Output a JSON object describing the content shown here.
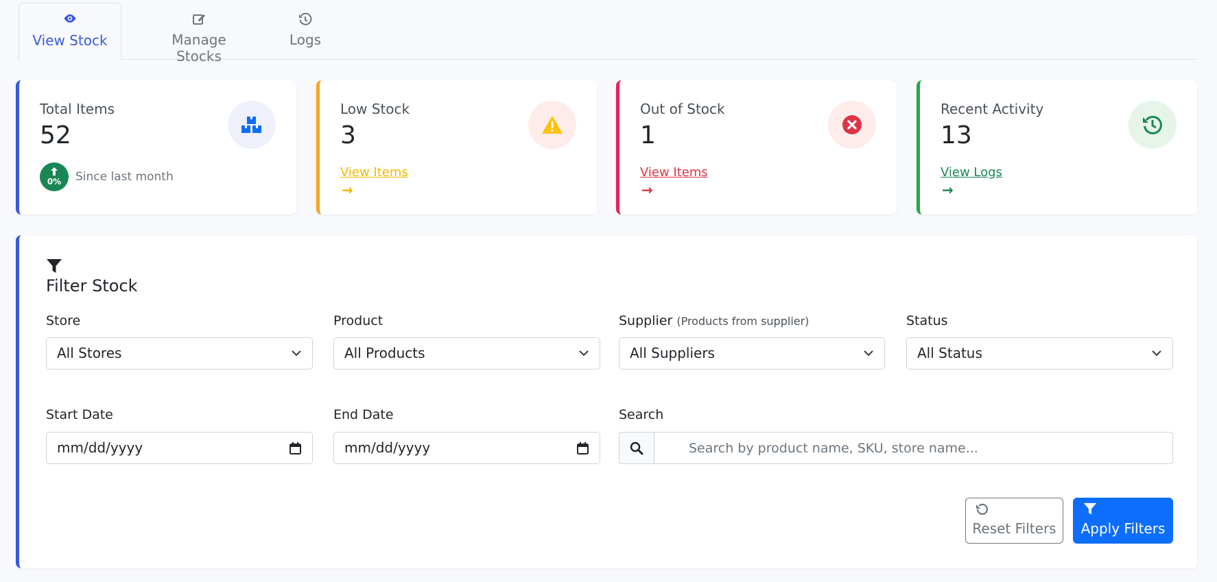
{
  "tabs": [
    {
      "label": "View Stock",
      "icon": "eye-icon"
    },
    {
      "label": "Manage Stocks",
      "icon": "edit-icon"
    },
    {
      "label": "Logs",
      "icon": "history-icon"
    }
  ],
  "cards": {
    "total": {
      "title": "Total Items",
      "value": "52",
      "badge_pct": "0%",
      "since": "Since last month",
      "icon": "boxes-icon",
      "accent": "#3a5bd9"
    },
    "low": {
      "title": "Low Stock",
      "value": "3",
      "link": "View Items",
      "icon": "warning-icon",
      "accent": "#f5a623"
    },
    "out": {
      "title": "Out of Stock",
      "value": "1",
      "link": "View Items",
      "icon": "x-circle-icon",
      "accent": "#e0245e"
    },
    "recent": {
      "title": "Recent Activity",
      "value": "13",
      "link": "View Logs",
      "icon": "history-icon",
      "accent": "#28a745"
    }
  },
  "filter": {
    "title": "Filter Stock",
    "store": {
      "label": "Store",
      "value": "All Stores"
    },
    "product": {
      "label": "Product",
      "value": "All Products"
    },
    "supplier": {
      "label": "Supplier",
      "hint": "(Products from supplier)",
      "value": "All Suppliers"
    },
    "status": {
      "label": "Status",
      "value": "All Status"
    },
    "start_date": {
      "label": "Start Date",
      "placeholder": "mm/dd/yyyy"
    },
    "end_date": {
      "label": "End Date",
      "placeholder": "mm/dd/yyyy"
    },
    "search": {
      "label": "Search",
      "placeholder": "Search by product name, SKU, store name..."
    },
    "reset_label": "Reset Filters",
    "apply_label": "Apply Filters"
  },
  "colors": {
    "primary": "#0d6efd",
    "tab_active": "#3a5bd9",
    "success": "#198754"
  }
}
